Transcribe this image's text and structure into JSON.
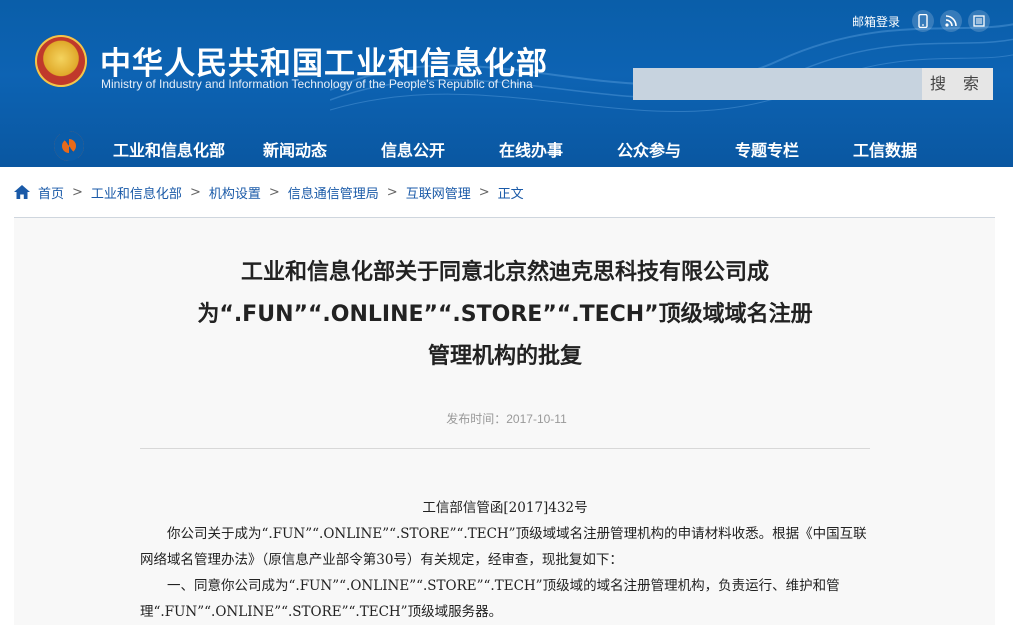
{
  "header": {
    "site_title": "中华人民共和国工业和信息化部",
    "site_subtitle": "Ministry of Industry and Information Technology of the People's Republic of China",
    "mail_login": "邮箱登录",
    "search_placeholder": "",
    "search_button": "搜 索"
  },
  "nav": {
    "items": [
      "工业和信息化部",
      "新闻动态",
      "信息公开",
      "在线办事",
      "公众参与",
      "专题专栏",
      "工信数据"
    ]
  },
  "breadcrumb": [
    "首页",
    "工业和信息化部",
    "机构设置",
    "信息通信管理局",
    "互联网管理",
    "正文"
  ],
  "article": {
    "title_line1": "工业和信息化部关于同意北京然迪克思科技有限公司成",
    "title_line2": "为“.FUN”“.ONLINE”“.STORE”“.TECH”顶级域域名注册",
    "title_line3": "管理机构的批复",
    "publish_label": "发布时间：",
    "publish_date": "2017-10-11",
    "doc_number": "工信部信管函[2017]432号",
    "para1": "你公司关于成为“.FUN”“.ONLINE”“.STORE”“.TECH”顶级域域名注册管理机构的申请材料收悉。根据《中国互联网络域名管理办法》（原信息产业部令第30号）有关规定，经审查，现批复如下：",
    "para2": "一、同意你公司成为“.FUN”“.ONLINE”“.STORE”“.TECH”顶级域的域名注册管理机构，负责运行、维护和管理“.FUN”“.ONLINE”“.STORE”“.TECH”顶级域服务器。"
  },
  "colors": {
    "header_blue": "#0d63b3",
    "link_blue": "#1a5aa8",
    "accent_orange": "#e86a1a"
  }
}
